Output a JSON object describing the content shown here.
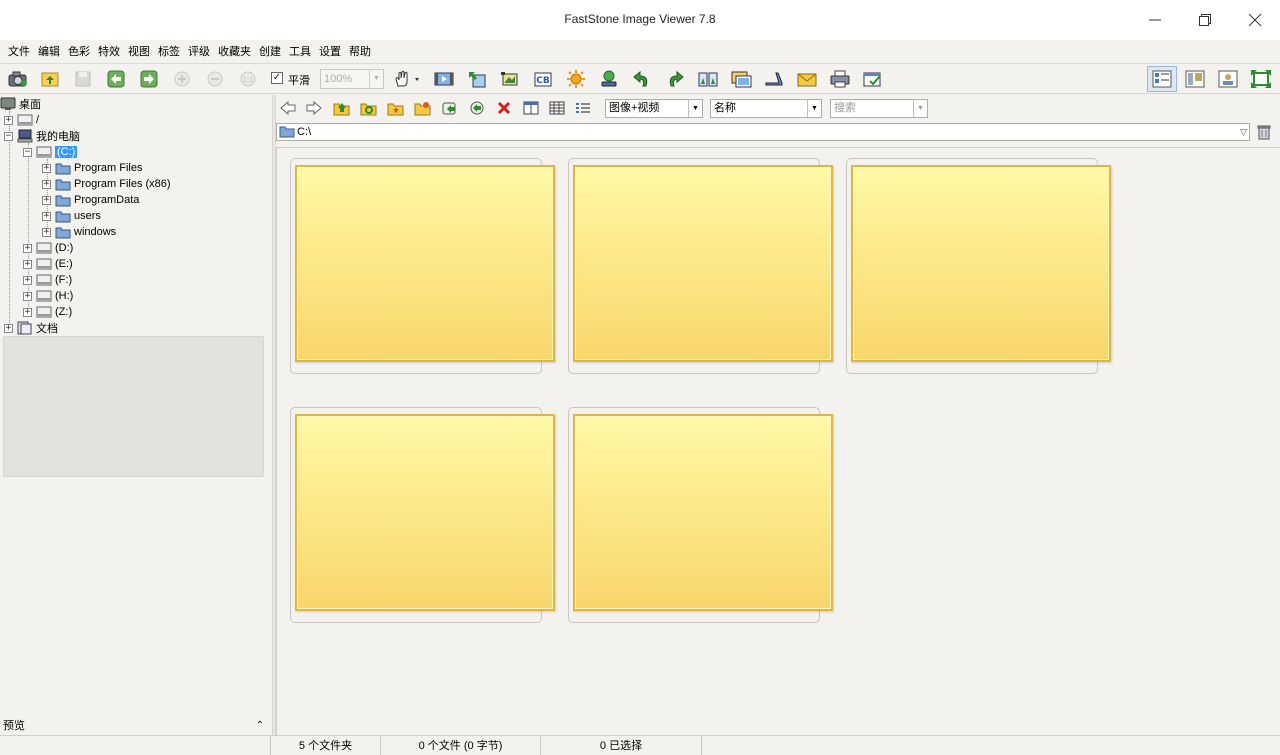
{
  "window": {
    "title": "FastStone Image Viewer 7.8"
  },
  "menu": [
    "文件",
    "编辑",
    "色彩",
    "特效",
    "视图",
    "标签",
    "评级",
    "收藏夹",
    "创建",
    "工具",
    "设置",
    "帮助"
  ],
  "toolbar": {
    "smooth_label": "平滑",
    "smooth_checked": "✓",
    "zoom_value": "100%",
    "icons": [
      "open-icon",
      "copy-to-folder-icon",
      "save-icon",
      "previous-icon",
      "next-icon",
      "zoom-in-icon",
      "zoom-out-icon",
      "actual-size-icon",
      "hand-tool-icon",
      "slideshow-icon",
      "resize-icon",
      "crop-icon",
      "compare-icon",
      "color-adjust-icon",
      "set-wallpaper-icon",
      "rotate-left-icon",
      "rotate-right-icon",
      "compare-images-icon",
      "multi-page-icon",
      "scan-icon",
      "email-icon",
      "print-icon",
      "batch-convert-icon"
    ],
    "view_modes": [
      "thumbnails-view-icon",
      "list-view-icon",
      "preview-view-icon",
      "fullscreen-icon"
    ]
  },
  "tree": {
    "desktop": "桌面",
    "root": "/",
    "my_computer": "我的电脑",
    "drive_c": "(C:)",
    "c_children": [
      "Program Files",
      "Program Files (x86)",
      "ProgramData",
      "users",
      "windows"
    ],
    "drives": [
      "(D:)",
      "(E:)",
      "(F:)",
      "(H:)",
      "(Z:)"
    ],
    "documents": "文档"
  },
  "preview": {
    "label": "预览",
    "toggle": "⌃"
  },
  "browser": {
    "filter_value": "图像+视频",
    "sort_value": "名称",
    "search_placeholder": "搜索",
    "address": "C:\\",
    "folder_count": 5
  },
  "status": {
    "folders": "5 个文件夹",
    "files": "0 个文件 (0 字节)",
    "selected": "0 已选择"
  },
  "colors": {
    "selection": "#3399ff",
    "folder_top": "#fff9a8",
    "folder_bottom": "#f8d66a",
    "folder_border": "#e0b540"
  }
}
